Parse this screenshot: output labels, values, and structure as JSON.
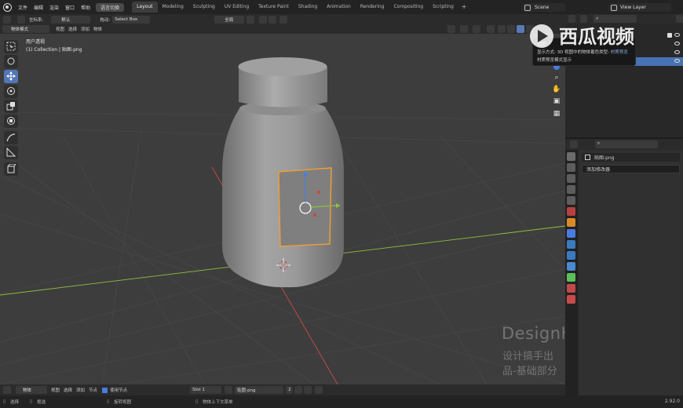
{
  "topbar": {
    "menu": [
      "文件",
      "编辑",
      "渲染",
      "窗口",
      "帮助"
    ],
    "lang_button": "语言切换",
    "workspaces": [
      "Layout",
      "Modeling",
      "Sculpting",
      "UV Editing",
      "Texture Paint",
      "Shading",
      "Animation",
      "Rendering",
      "Compositing",
      "Scripting"
    ],
    "active_workspace": "Layout",
    "scene": "Scene",
    "view_layer": "View Layer"
  },
  "tool_header": {
    "coord_label": "坐标系:",
    "coord_value": "默认",
    "drag_label": "拖动:",
    "drag_value": "Select Box",
    "global": "全局"
  },
  "viewport_header": {
    "mode": "物体模式",
    "menus": [
      "视图",
      "选择",
      "添加",
      "物体"
    ]
  },
  "viewport": {
    "view_name": "用户透视",
    "collection_info": "(1) Collection | 贴图-png"
  },
  "tooltip": {
    "line1": "视图",
    "line2_prefix": "显示方式: 3D 视图中的物体着色类型:",
    "line2_highlight": "材质预览",
    "line3": "材质预览模式显示"
  },
  "watermark": {
    "logo_text": "西瓜视频",
    "line1": "DesignHunting",
    "line2": "设计搞手出品-基础部分"
  },
  "properties": {
    "object_name": "贴图-png",
    "add_modifier": "添加修改器"
  },
  "bottom_bar": {
    "object_label": "物体",
    "menus": [
      "视图",
      "选择",
      "添加",
      "节点"
    ],
    "use_nodes": "使用节点",
    "slot": "Slot 1",
    "material": "贴图-png",
    "users": "2"
  },
  "statusbar": {
    "items": [
      "选择",
      "框选",
      "旋转视图",
      "物体上下文菜单"
    ],
    "version": "2.92.0"
  },
  "colors": {
    "accent": "#4772b3",
    "viewport_bg": "#3d3d3d",
    "selection_outline": "#f0a030",
    "x_axis": "#c94a4a",
    "y_axis": "#8ec13c"
  }
}
